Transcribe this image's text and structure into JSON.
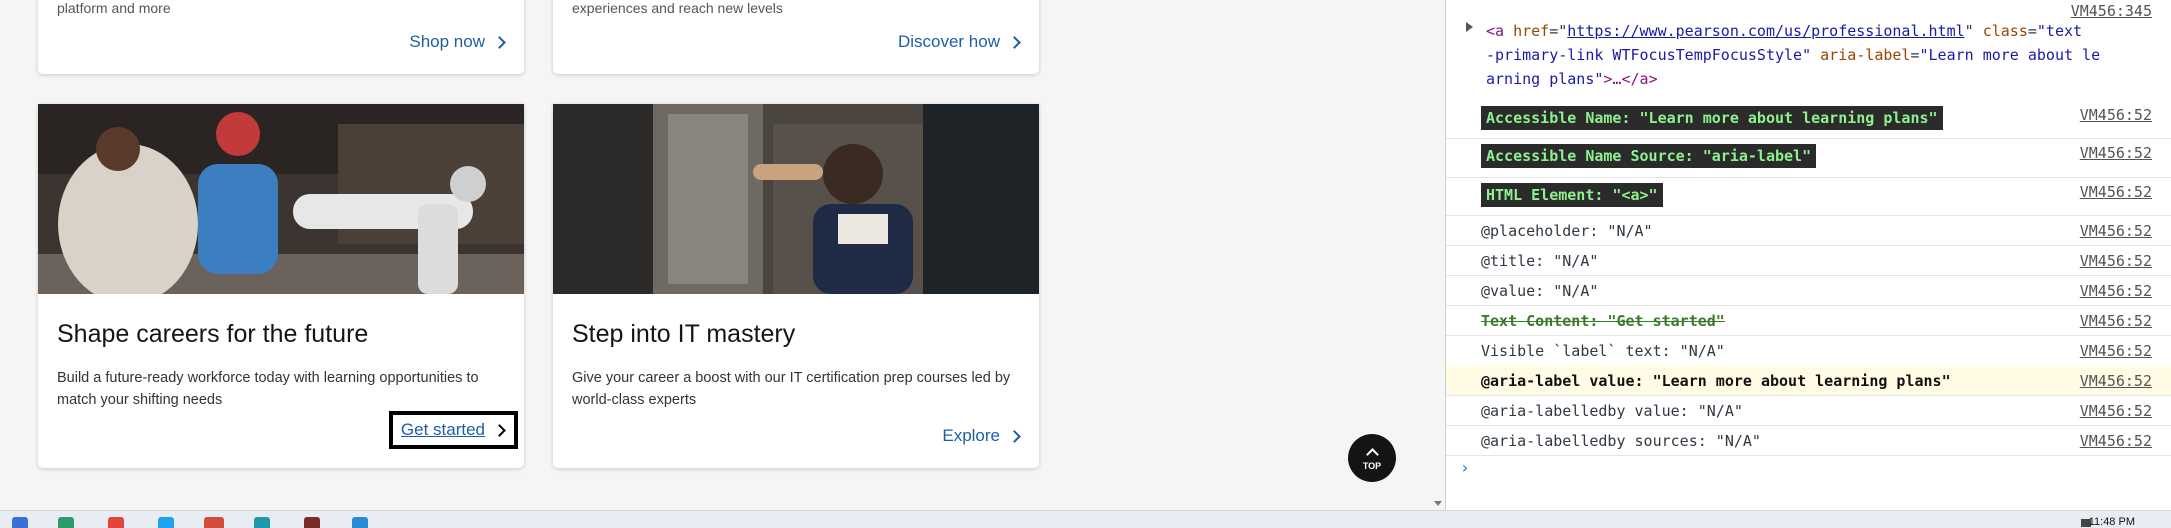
{
  "cards_top": [
    {
      "desc_fragment": "platform and more",
      "link": "Shop now"
    },
    {
      "desc_fragment": "experiences and reach new levels",
      "link": "Discover how"
    }
  ],
  "cards": [
    {
      "title": "Shape careers for the future",
      "desc": "Build a future-ready workforce today with learning opportunities to match your shifting needs",
      "link": "Get started"
    },
    {
      "title": "Step into IT mastery",
      "desc": "Give your career a boost with our IT certification prep courses led by world-class experts",
      "link": "Explore"
    }
  ],
  "top_button": {
    "label": "TOP"
  },
  "devtools": {
    "source_top": "VM456:345",
    "element": {
      "tag_open": "<a ",
      "href_attr": "href",
      "href": "https://www.pearson.com/us/professional.html",
      "class_attr": "class",
      "class_val": "\"text",
      "class_val2": "-primary-link WTFocusTempFocusStyle\"",
      "aria_attr": "aria-label",
      "aria_val": "\"Learn more about le",
      "aria_val2": "arning plans\"",
      "tail": ">…</a>"
    },
    "rows": [
      {
        "text": "Accessible Name: \"Learn more about learning plans\"",
        "source": "VM456:52"
      },
      {
        "text": "Accessible Name Source: \"aria-label\"",
        "source": "VM456:52"
      },
      {
        "text": "HTML Element: \"<a>\"",
        "source": "VM456:52"
      },
      {
        "text": "@placeholder: \"N/A\"",
        "source": "VM456:52"
      },
      {
        "text": "@title: \"N/A\"",
        "source": "VM456:52"
      },
      {
        "text": "@value: \"N/A\"",
        "source": "VM456:52"
      },
      {
        "text": "Text Content: \"Get started\"",
        "source": "VM456:52"
      },
      {
        "text": "Visible `label` text: \"N/A\"",
        "source": "VM456:52"
      },
      {
        "text": "@aria-label value: \"Learn more about learning plans\"",
        "source": "VM456:52"
      },
      {
        "text": "@aria-labelledby value: \"N/A\"",
        "source": "VM456:52"
      },
      {
        "text": "@aria-labelledby sources: \"N/A\"",
        "source": "VM456:52"
      }
    ],
    "prompt": "›"
  },
  "taskbar": {
    "time": "11:48 PM"
  },
  "colors": {
    "link": "#1c5fa8",
    "highlight_bg": "#2b2b2b",
    "highlight_fg": "#8df28d"
  },
  "icons": [
    "chevron-right-icon",
    "chevron-up-icon",
    "expand-triangle-icon"
  ]
}
